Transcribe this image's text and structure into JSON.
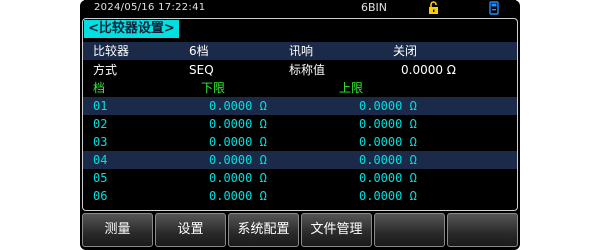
{
  "status": {
    "datetime": "2024/05/16 17:22:41",
    "bin": "6BIN",
    "lock_icon": "lock-icon",
    "usb_icon": "usb-icon",
    "accent": "#ffcc00",
    "usb_color": "#1e90ff"
  },
  "page": {
    "title": "<比较器设置>"
  },
  "settings": {
    "comparator_label": "比较器",
    "comparator_value": "6档",
    "beep_label": "讯响",
    "beep_value": "关闭",
    "mode_label": "方式",
    "mode_value": "SEQ",
    "nominal_label": "标称值",
    "nominal_value": "0.0000 Ω"
  },
  "table": {
    "headers": {
      "bin": "档",
      "low": "下限",
      "high": "上限"
    },
    "rows": [
      {
        "bin": "01",
        "low": "0.0000 Ω",
        "high": "0.0000 Ω"
      },
      {
        "bin": "02",
        "low": "0.0000 Ω",
        "high": "0.0000 Ω"
      },
      {
        "bin": "03",
        "low": "0.0000 Ω",
        "high": "0.0000 Ω"
      },
      {
        "bin": "04",
        "low": "0.0000 Ω",
        "high": "0.0000 Ω"
      },
      {
        "bin": "05",
        "low": "0.0000 Ω",
        "high": "0.0000 Ω"
      },
      {
        "bin": "06",
        "low": "0.0000 Ω",
        "high": "0.0000 Ω"
      }
    ]
  },
  "softkeys": [
    {
      "label": "测量"
    },
    {
      "label": "设置"
    },
    {
      "label": "系统配置"
    },
    {
      "label": "文件管理"
    },
    {
      "label": ""
    },
    {
      "label": ""
    }
  ]
}
